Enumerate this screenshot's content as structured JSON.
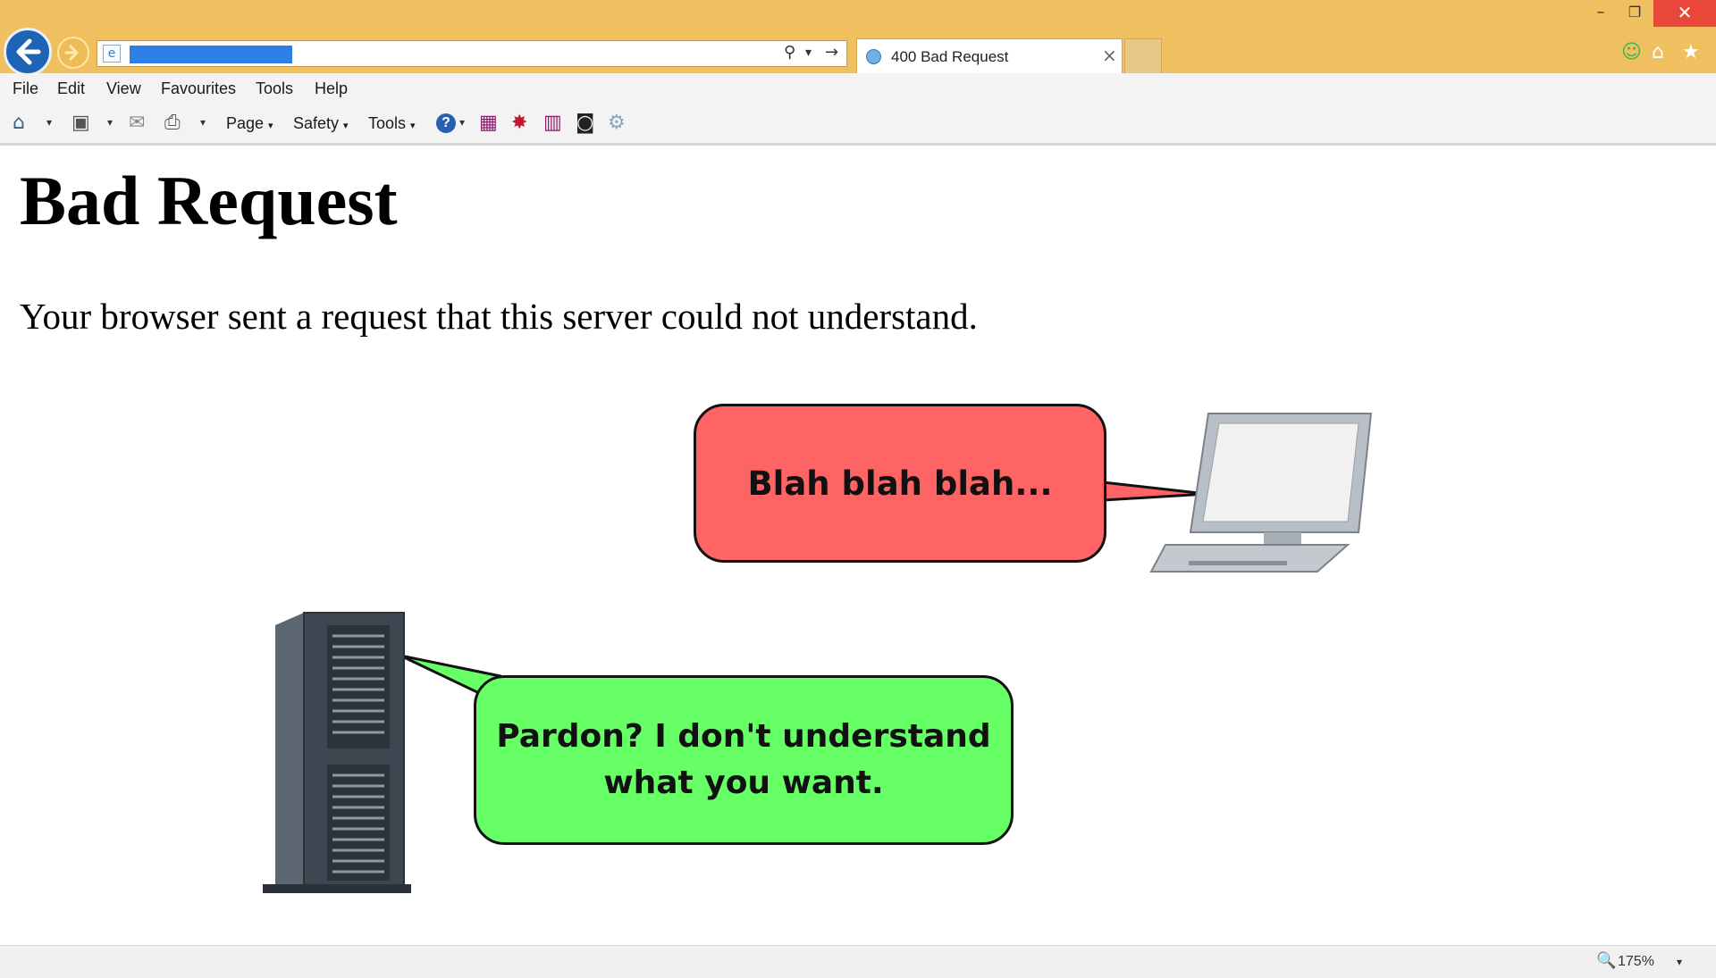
{
  "window": {
    "minimize_glyph": "–",
    "restore_glyph": "❐",
    "close_glyph": "✕"
  },
  "address_bar": {
    "page_icon_glyph": "e",
    "search_glyph": "⚲",
    "dropdown_glyph": "▾",
    "go_glyph": "→"
  },
  "tab": {
    "title": "400 Bad Request",
    "close_glyph": "×"
  },
  "right_icons": {
    "smiley_glyph": "☺",
    "home_glyph": "⌂",
    "favorites_glyph": "★"
  },
  "menu": [
    "File",
    "Edit",
    "View",
    "Favourites",
    "Tools",
    "Help"
  ],
  "command_bar": {
    "home_glyph": "⌂",
    "feeds_glyph": "▣",
    "mail_glyph": "✉",
    "print_glyph": "⎙",
    "dropdown_glyph": "▾",
    "page_label": "Page",
    "safety_label": "Safety",
    "tools_label": "Tools",
    "help_glyph": "?",
    "extra_glyphs": [
      "▦",
      "✸",
      "▥",
      "◙",
      "⚙"
    ]
  },
  "page": {
    "heading": "Bad Request",
    "message": "Your browser sent a request that this server could not understand."
  },
  "illustration": {
    "client_speech": "Blah blah blah...",
    "server_speech": "Pardon? I don't understand what you want."
  },
  "status_bar": {
    "zoom_glyph": "🔍",
    "zoom": "175%",
    "zoom_dropdown_glyph": "▾"
  },
  "colors": {
    "frame": "#f0bf5f",
    "client_bubble": "#ff6464",
    "server_bubble": "#66ff66",
    "back_button": "#1f63b5",
    "close_button": "#e8473a"
  }
}
